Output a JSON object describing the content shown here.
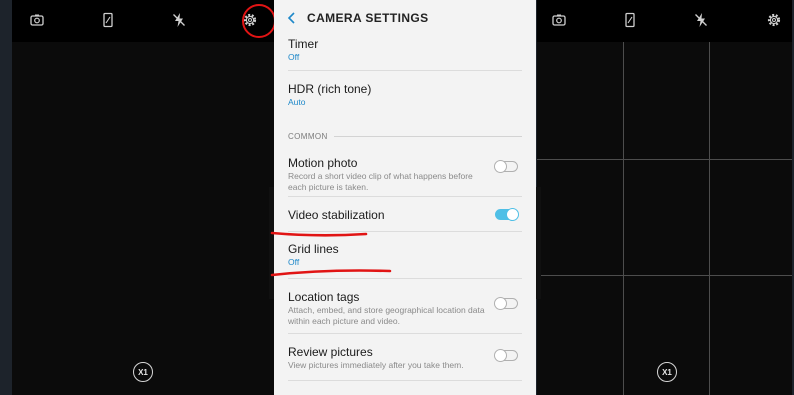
{
  "header": {
    "back_label": "<",
    "title": "CAMERA SETTINGS"
  },
  "settings": {
    "timer": {
      "label": "Timer",
      "value": "Off"
    },
    "hdr": {
      "label": "HDR (rich tone)",
      "value": "Auto"
    },
    "section_common": "COMMON",
    "motion_photo": {
      "label": "Motion photo",
      "desc": "Record a short video clip of what happens before each picture is taken.",
      "enabled": false
    },
    "video_stabilization": {
      "label": "Video stabilization",
      "enabled": true
    },
    "grid_lines": {
      "label": "Grid lines",
      "value": "Off"
    },
    "location_tags": {
      "label": "Location tags",
      "desc": "Attach, embed, and store geographical location data within each picture and video.",
      "enabled": false
    },
    "review_pictures": {
      "label": "Review pictures",
      "desc": "View pictures immediately after you take them.",
      "enabled": false
    }
  },
  "camera": {
    "zoom_label": "X1"
  },
  "icons": [
    "switch-camera-icon",
    "aspect-ratio-icon",
    "flash-off-icon",
    "settings-gear-icon"
  ],
  "colors": {
    "accent": "#1e88c9",
    "annotation": "#e11414",
    "toggle_on": "#4fbfe6"
  }
}
